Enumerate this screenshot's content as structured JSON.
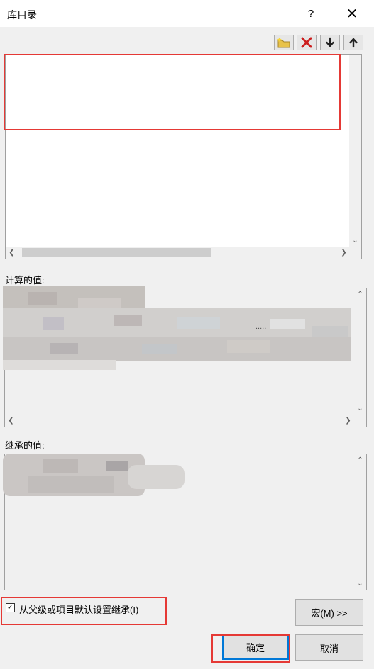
{
  "window": {
    "title": "库目录",
    "help": "?",
    "close": "✕"
  },
  "toolbar": {
    "new_icon": "new-folder-icon",
    "delete_icon": "delete-icon",
    "down_icon": "move-down-icon",
    "up_icon": "move-up-icon",
    "delete_color": "#cc1f1f"
  },
  "sections": {
    "computed_label": "计算的值:",
    "inherited_label": "继承的值:"
  },
  "computed_partial": ".....",
  "inherit": {
    "checked": true,
    "label": "从父级或项目默认设置继承(I)"
  },
  "buttons": {
    "macro": "宏(M) >>",
    "ok": "确定",
    "cancel": "取消"
  },
  "colors": {
    "highlight": "#e53935",
    "focus": "#0078d7"
  }
}
